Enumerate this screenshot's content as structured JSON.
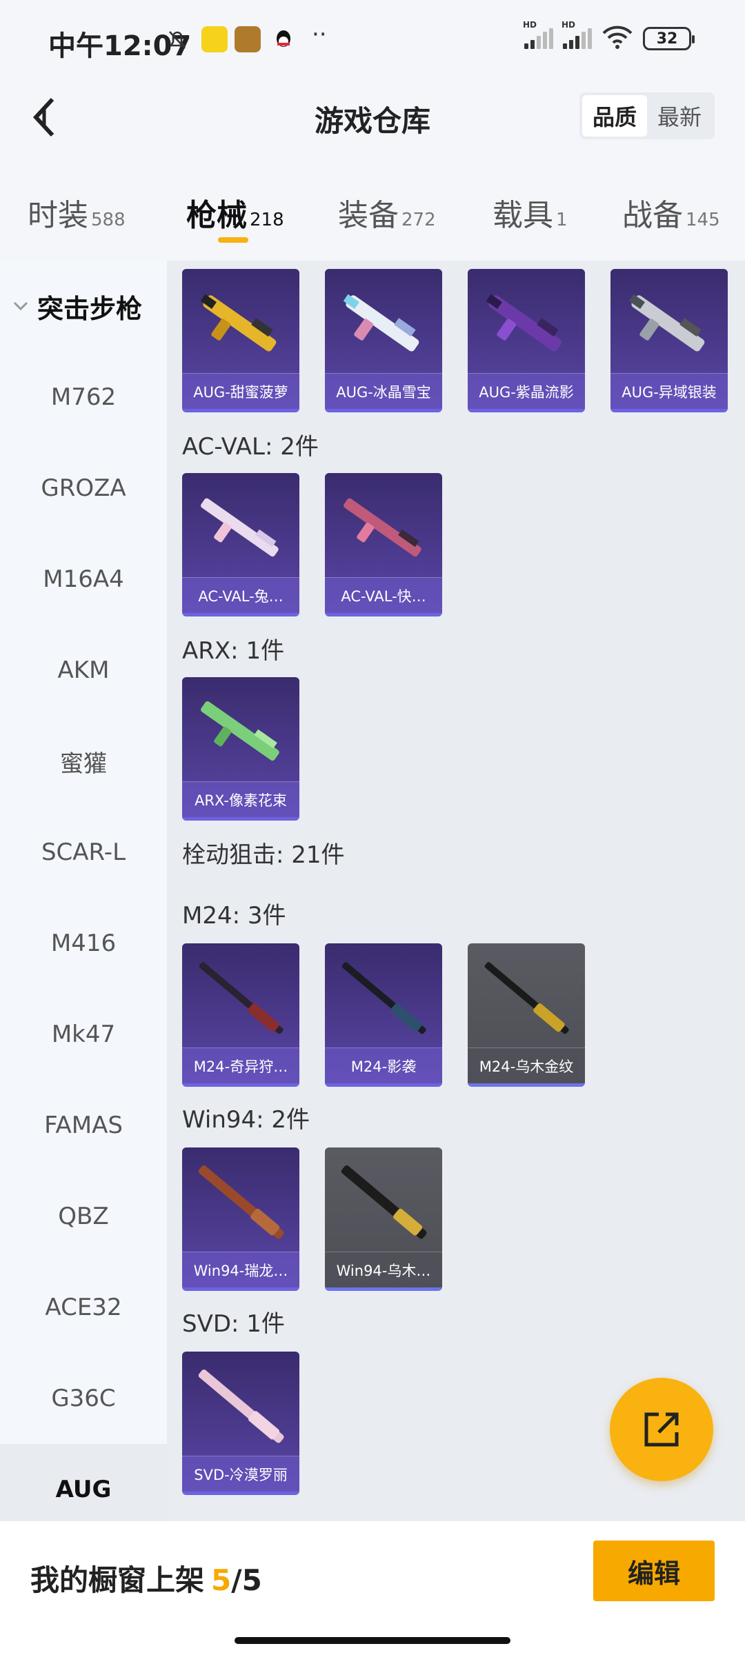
{
  "status_bar": {
    "time": "中午12:07",
    "battery": "32",
    "signal_label_1": "HD",
    "signal_label_2": "HD",
    "more": "··"
  },
  "header": {
    "title": "游戏仓库",
    "sort_options": [
      "品质",
      "最新"
    ],
    "active_sort": "品质"
  },
  "tabs": [
    {
      "label": "时装",
      "count": "588"
    },
    {
      "label": "枪械",
      "count": "218"
    },
    {
      "label": "装备",
      "count": "272"
    },
    {
      "label": "载具",
      "count": "1"
    },
    {
      "label": "战备",
      "count": "145"
    }
  ],
  "active_tab": "枪械",
  "sidebar": {
    "group": "突击步枪",
    "items": [
      "M762",
      "GROZA",
      "M16A4",
      "AKM",
      "蜜獾",
      "SCAR-L",
      "M416",
      "Mk47",
      "FAMAS",
      "QBZ",
      "ACE32",
      "G36C",
      "AUG"
    ],
    "active": "AUG"
  },
  "content": {
    "aug_items": [
      "AUG-甜蜜菠萝",
      "AUG-冰晶雪宝",
      "AUG-紫晶流影",
      "AUG-异域银装"
    ],
    "sections": [
      {
        "title": "AC-VAL: 2件",
        "items": [
          "AC-VAL-兔…",
          "AC-VAL-快…"
        ]
      },
      {
        "title": "ARX: 1件",
        "items": [
          "ARX-像素花束"
        ]
      },
      {
        "title": "栓动狙击: 21件",
        "items": []
      },
      {
        "title": "M24: 3件",
        "items": [
          "M24-奇异狩…",
          "M24-影袭",
          "M24-乌木金纹"
        ]
      },
      {
        "title": "Win94: 2件",
        "items": [
          "Win94-瑞龙…",
          "Win94-乌木…"
        ]
      },
      {
        "title": "SVD: 1件",
        "items": [
          "SVD-冷漠罗丽"
        ]
      }
    ]
  },
  "bottom_bar": {
    "label": "我的橱窗上架",
    "current": "5",
    "slash": "/",
    "total": "5",
    "edit_label": "编辑"
  },
  "colors": {
    "accent": "#f7a900",
    "card_purple": "#4d3b8f",
    "card_grey": "#55565d"
  }
}
